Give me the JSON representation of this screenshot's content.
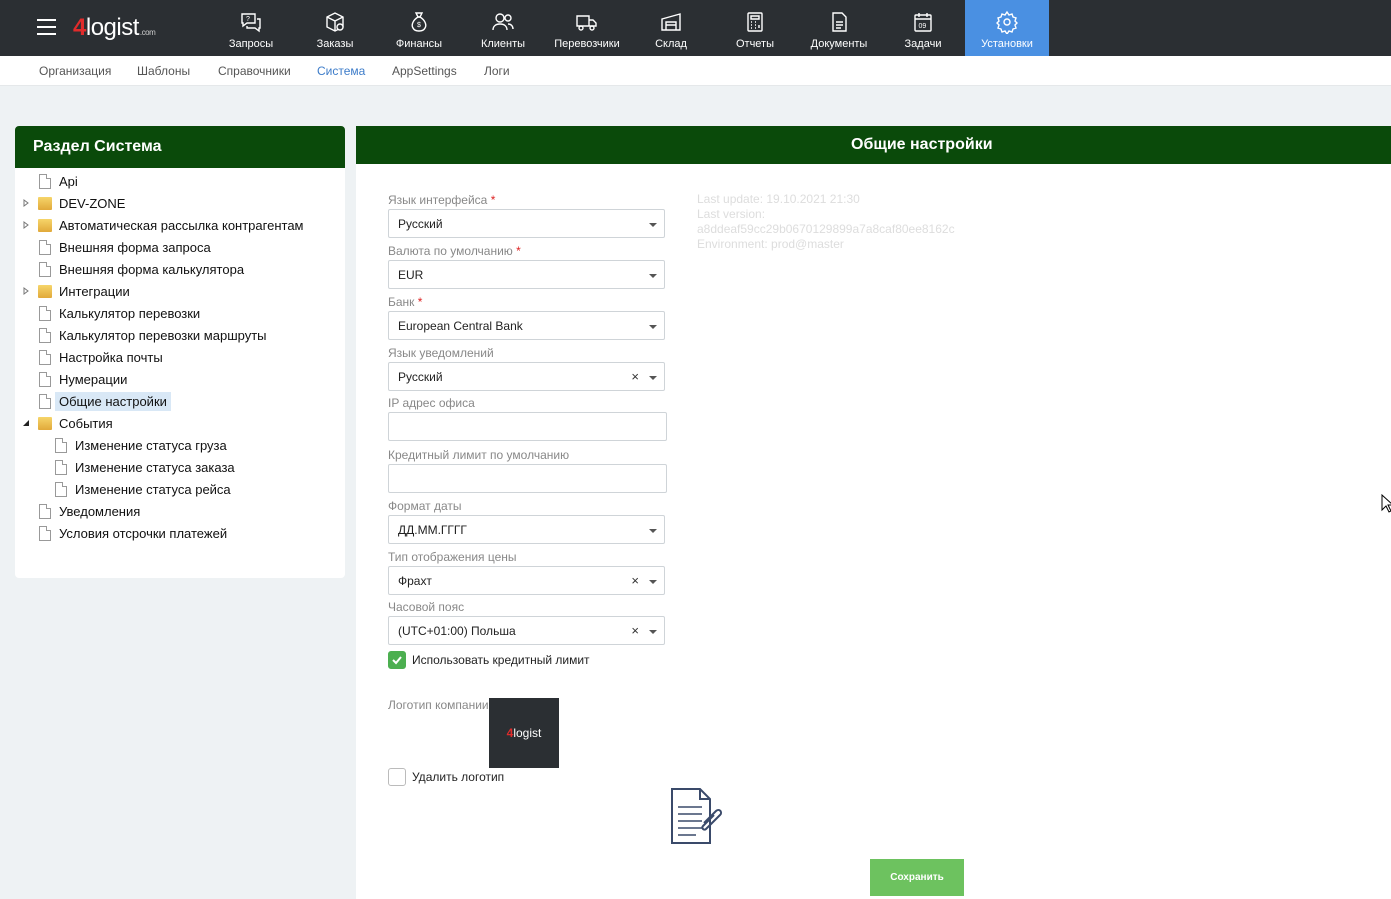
{
  "app": {
    "logo_main": "logist",
    "logo_prefix": "4",
    "logo_suffix": ".com"
  },
  "nav": [
    {
      "label": "Запросы",
      "icon": "chat-question-icon"
    },
    {
      "label": "Заказы",
      "icon": "box-icon"
    },
    {
      "label": "Финансы",
      "icon": "money-bag-icon"
    },
    {
      "label": "Клиенты",
      "icon": "users-icon"
    },
    {
      "label": "Перевозчики",
      "icon": "truck-icon"
    },
    {
      "label": "Склад",
      "icon": "warehouse-icon"
    },
    {
      "label": "Отчеты",
      "icon": "calculator-icon"
    },
    {
      "label": "Документы",
      "icon": "document-icon"
    },
    {
      "label": "Задачи",
      "icon": "calendar-icon"
    },
    {
      "label": "Установки",
      "icon": "gear-icon"
    }
  ],
  "calendar_day": "09",
  "subnav": [
    "Организация",
    "Шаблоны",
    "Справочники",
    "Система",
    "AppSettings",
    "Логи"
  ],
  "left": {
    "title": "Раздел Система",
    "items": [
      {
        "label": "Api"
      },
      {
        "label": "DEV-ZONE"
      },
      {
        "label": "Автоматическая рассылка контрагентам"
      },
      {
        "label": "Внешняя форма запроса"
      },
      {
        "label": "Внешняя форма калькулятора"
      },
      {
        "label": "Интеграции"
      },
      {
        "label": "Калькулятор перевозки"
      },
      {
        "label": "Калькулятор перевозки маршруты"
      },
      {
        "label": "Настройка почты"
      },
      {
        "label": "Нумерации"
      },
      {
        "label": "Общие настройки"
      },
      {
        "label": "События"
      },
      {
        "label": "Изменение статуса груза"
      },
      {
        "label": "Изменение статуса заказа"
      },
      {
        "label": "Изменение статуса рейса"
      },
      {
        "label": "Уведомления"
      },
      {
        "label": "Условия отсрочки платежей"
      }
    ]
  },
  "right": {
    "title": "Общие настройки",
    "fields": {
      "ui_lang": {
        "label": "Язык интерфейса",
        "value": "Русский"
      },
      "currency": {
        "label": "Валюта по умолчанию",
        "value": "EUR"
      },
      "bank": {
        "label": "Банк",
        "value": "European Central Bank"
      },
      "notify_lang": {
        "label": "Язык уведомлений",
        "value": "Русский"
      },
      "ip": {
        "label": "IP адрес офиса",
        "value": ""
      },
      "credit": {
        "label": "Кредитный лимит по умолчанию",
        "value": ""
      },
      "date_format": {
        "label": "Формат даты",
        "value": "ДД.ММ.ГГГГ"
      },
      "price_type": {
        "label": "Тип отображения цены",
        "value": "Фрахт"
      },
      "timezone": {
        "label": "Часовой пояс",
        "value": "(UTC+01:00) Польша"
      }
    },
    "required_mark": "*",
    "clear_glyph": "×",
    "use_credit": "Использовать кредитный лимит",
    "logo_label": "Логотип компании",
    "delete_logo": "Удалить логотип",
    "save": "Сохранить",
    "info": {
      "last_update": "Last update: 19.10.2021 21:30",
      "last_version_label": "Last version:",
      "last_version_hash": "a8ddeaf59cc29b0670129899a7a8caf80ee8162c",
      "environment": "Environment: prod@master"
    }
  }
}
